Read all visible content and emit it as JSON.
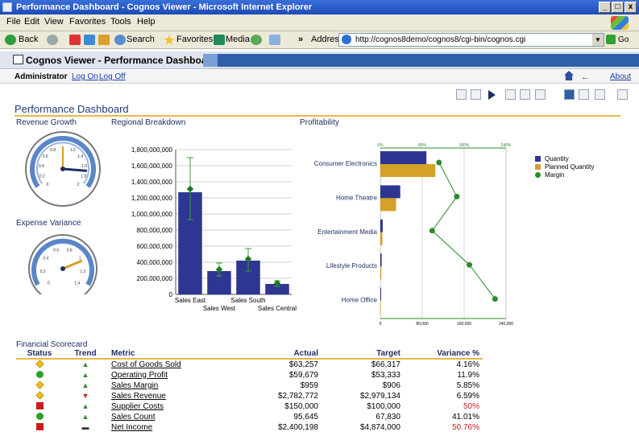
{
  "window": {
    "title": "Performance Dashboard - Cognos Viewer - Microsoft Internet Explorer",
    "buttons": [
      "_",
      "8",
      "x"
    ]
  },
  "menu": [
    "File",
    "Edit",
    "View",
    "Favorites",
    "Tools",
    "Help"
  ],
  "toolbar": {
    "back": "Back",
    "search": "Search",
    "favorites": "Favorites",
    "media": "Media",
    "address_label": "Address",
    "address": "http://cognos8demo/cognos8/cgi-bin/cognos.cgi",
    "go": "Go"
  },
  "cognos": {
    "title": "Cognos Viewer - Performance Dashboard",
    "user": "Administrator",
    "log_on": "Log On",
    "log_off": "Log Off",
    "about": "About"
  },
  "report": {
    "title": "Performance Dashboard",
    "sections": {
      "revenue_growth": "Revenue Growth",
      "regional_breakdown": "Regional Breakdown",
      "profitability": "Profitability",
      "expense_variance": "Expense Variance",
      "financial_scorecard": "Financial Scorecard"
    }
  },
  "gauges": [
    {
      "name": "Revenue Growth",
      "ticks": [
        "0.8",
        "1.2",
        "0.6",
        "1.4",
        "0.4",
        "1.6",
        "0.2",
        "1.8",
        "0",
        "2"
      ],
      "needle_values": [
        1.0,
        1.7
      ]
    },
    {
      "name": "Expense Variance",
      "ticks": [
        "0.6",
        "0.8",
        "0.4",
        "1",
        "0.2",
        "1.2",
        "0",
        "1.4"
      ],
      "needle_values": [
        1.05
      ]
    }
  ],
  "chart_data": [
    {
      "type": "bar",
      "title": "Regional Breakdown",
      "categories": [
        "Sales East",
        "Sales West",
        "Sales South",
        "Sales Central"
      ],
      "values": [
        1270000000,
        290000000,
        420000000,
        130000000
      ],
      "error_high": [
        1700000000,
        390000000,
        570000000,
        170000000
      ],
      "error_low": [
        930000000,
        230000000,
        290000000,
        100000000
      ],
      "markers": [
        1310000000,
        310000000,
        440000000,
        140000000
      ],
      "ylim": [
        0,
        1800000000
      ],
      "yticks": [
        "1,800,000,000",
        "1,600,000,000",
        "1,400,000,000",
        "1,200,000,000",
        "1,000,000,000",
        "800,000,000",
        "600,000,000",
        "400,000,000",
        "200,000,000",
        "0"
      ],
      "colors": {
        "bar": "#2e3592",
        "marker": "#1f7a1f",
        "error": "#3aa03a"
      }
    },
    {
      "type": "bar",
      "title": "Profitability",
      "categories": [
        "Consumer Electronics",
        "Home Theatre",
        "Entertainment Media",
        "Lifestyle Products",
        "Home Office"
      ],
      "series": [
        {
          "name": "Quantity",
          "values": [
            88000,
            38000,
            4500,
            2500,
            1500
          ]
        },
        {
          "name": "Planned Quantity",
          "values": [
            105000,
            30000,
            4000,
            2000,
            1000
          ]
        },
        {
          "name": "Margin",
          "values": [
            112,
            146,
            99,
            170,
            219
          ]
        }
      ],
      "xlim": [
        0,
        240000
      ],
      "xticks": [
        "0",
        "80,000",
        "160,000",
        "240,000"
      ],
      "x2ticks": [
        "0%",
        "80%",
        "160%",
        "240%"
      ],
      "legend": "right",
      "colors": {
        "Quantity": "#2e3592",
        "Planned Quantity": "#d4a22a",
        "Margin": "#2d8a2d"
      }
    }
  ],
  "scorecard": {
    "headers": [
      "Status",
      "Trend",
      "Metric",
      "Actual",
      "Target",
      "Variance %"
    ],
    "rows": [
      {
        "status": "diamond",
        "trend": "up",
        "metric": "Cost of Goods Sold",
        "actual": "$63,257",
        "target": "$66,317",
        "variance": "4.16%",
        "bad": false
      },
      {
        "status": "circle",
        "trend": "up",
        "metric": "Operating Profit",
        "actual": "$59,679",
        "target": "$53,333",
        "variance": "11.9%",
        "bad": false
      },
      {
        "status": "diamond",
        "trend": "up",
        "metric": "Sales Margin",
        "actual": "$959",
        "target": "$906",
        "variance": "5.85%",
        "bad": false
      },
      {
        "status": "diamond",
        "trend": "down",
        "metric": "Sales Revenue",
        "actual": "$2,782,772",
        "target": "$2,979,134",
        "variance": "6.59%",
        "bad": false
      },
      {
        "status": "square",
        "trend": "up",
        "metric": "Supplier Costs",
        "actual": "$150,000",
        "target": "$100,000",
        "variance": "50%",
        "bad": true
      },
      {
        "status": "circle",
        "trend": "up",
        "metric": "Sales Count",
        "actual": "95,645",
        "target": "67,830",
        "variance": "41.01%",
        "bad": false
      },
      {
        "status": "square",
        "trend": "flat",
        "metric": "Net Income",
        "actual": "$2,400,198",
        "target": "$4,874,000",
        "variance": "50.76%",
        "bad": true
      }
    ]
  }
}
